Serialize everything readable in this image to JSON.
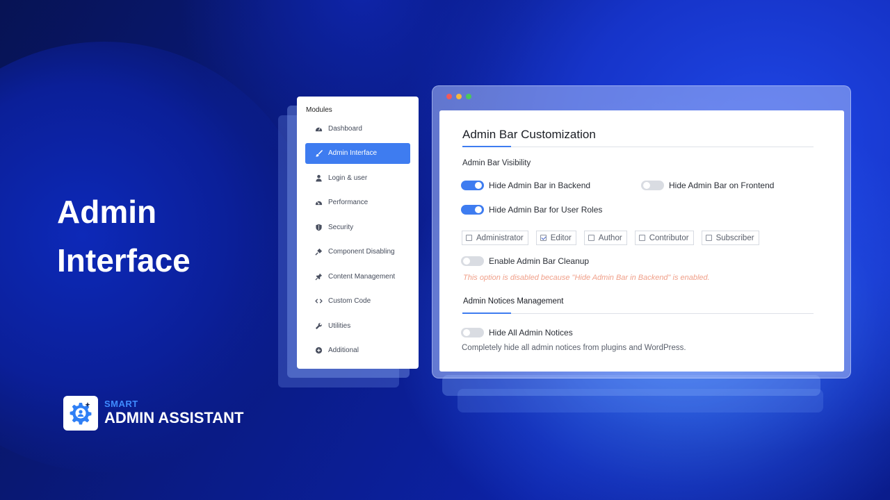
{
  "hero": {
    "line1": "Admin",
    "line2": "Interface"
  },
  "logo": {
    "small": "SMART",
    "big": "ADMIN ASSISTANT"
  },
  "sidebar": {
    "title": "Modules",
    "items": [
      {
        "label": "Dashboard",
        "icon": "gauge-icon"
      },
      {
        "label": "Admin Interface",
        "icon": "paintbrush-icon",
        "active": true
      },
      {
        "label": "Login & user",
        "icon": "user-icon"
      },
      {
        "label": "Performance",
        "icon": "speedometer-icon"
      },
      {
        "label": "Security",
        "icon": "shield-icon"
      },
      {
        "label": "Component Disabling",
        "icon": "plug-icon"
      },
      {
        "label": "Content Management",
        "icon": "pin-icon"
      },
      {
        "label": "Custom Code",
        "icon": "code-icon"
      },
      {
        "label": "Utilities",
        "icon": "wrench-icon"
      },
      {
        "label": "Additional",
        "icon": "plus-circle-icon"
      }
    ]
  },
  "window": {
    "dots": [
      "#f05a5a",
      "#f5b83d",
      "#4cc85a"
    ],
    "title": "Admin Bar Customization",
    "visibility_label": "Admin Bar Visibility",
    "toggles": {
      "backend": {
        "label": "Hide Admin Bar in Backend",
        "on": true
      },
      "frontend": {
        "label": "Hide Admin Bar on Frontend",
        "on": false
      },
      "roles": {
        "label": "Hide Admin Bar for User Roles",
        "on": true
      },
      "cleanup": {
        "label": "Enable Admin Bar Cleanup",
        "on": false
      },
      "notices": {
        "label": "Hide All Admin Notices",
        "on": false
      }
    },
    "roles": [
      {
        "label": "Administrator",
        "checked": false
      },
      {
        "label": "Editor",
        "checked": true
      },
      {
        "label": "Author",
        "checked": false
      },
      {
        "label": "Contributor",
        "checked": false
      },
      {
        "label": "Subscriber",
        "checked": false
      }
    ],
    "warning": "This option is disabled because \"Hide Admin Bar in Backend\" is enabled.",
    "notices_title": "Admin Notices Management",
    "notices_desc": "Completely hide all admin notices from plugins and WordPress."
  },
  "colors": {
    "accent": "#3e7cf0",
    "logo_accent": "#3f8cff",
    "warning": "#f0a08a"
  }
}
